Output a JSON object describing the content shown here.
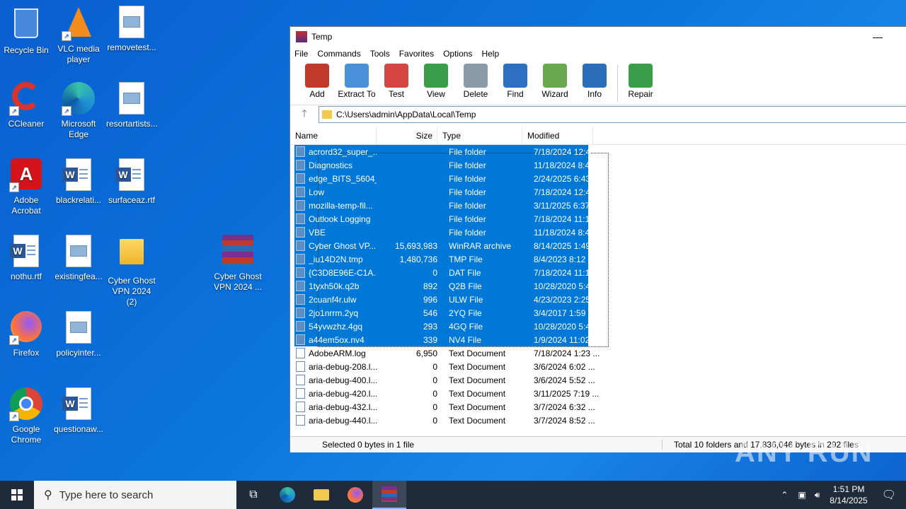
{
  "desktop": {
    "icons": [
      {
        "label": "Recycle Bin"
      },
      {
        "label": "VLC media player"
      },
      {
        "label": "removetest..."
      },
      {
        "label": "CCleaner"
      },
      {
        "label": "Microsoft Edge"
      },
      {
        "label": "resortartists..."
      },
      {
        "label": "Adobe Acrobat"
      },
      {
        "label": "blackrelati..."
      },
      {
        "label": "surfaceaz.rtf"
      },
      {
        "label": "nothu.rtf"
      },
      {
        "label": "existingfea..."
      },
      {
        "label": "Cyber Ghost VPN 2024 (2)"
      },
      {
        "label": "Cyber Ghost VPN 2024 ..."
      },
      {
        "label": "Firefox"
      },
      {
        "label": "policyinter..."
      },
      {
        "label": "Google Chrome"
      },
      {
        "label": "questionaw..."
      }
    ]
  },
  "window": {
    "title": "Temp",
    "minimize_glyph": "—",
    "menu": [
      "File",
      "Commands",
      "Tools",
      "Favorites",
      "Options",
      "Help"
    ],
    "toolbar": [
      {
        "label": "Add",
        "icon": "add-archive-icon",
        "color": "#c0392b"
      },
      {
        "label": "Extract To",
        "icon": "extract-folder-icon",
        "color": "#4a90d9"
      },
      {
        "label": "Test",
        "icon": "test-clipboard-icon",
        "color": "#d64541"
      },
      {
        "label": "View",
        "icon": "view-book-icon",
        "color": "#3a9d4a"
      },
      {
        "label": "Delete",
        "icon": "trash-icon",
        "color": "#8a9aa8"
      },
      {
        "label": "Find",
        "icon": "magnifier-icon",
        "color": "#2d6fc0"
      },
      {
        "label": "Wizard",
        "icon": "wand-icon",
        "color": "#6aa84f"
      },
      {
        "label": "Info",
        "icon": "info-icon",
        "color": "#2a6db8"
      },
      {
        "label": "Repair",
        "icon": "repair-icon",
        "color": "#3a9d4a"
      }
    ],
    "address": "C:\\Users\\admin\\AppData\\Local\\Temp",
    "columns": {
      "name": "Name",
      "size": "Size",
      "type": "Type",
      "modified": "Modified"
    },
    "files": [
      {
        "name": "acrord32_super_...",
        "size": "",
        "type": "File folder",
        "modified": "7/18/2024 12:4...",
        "selected": true
      },
      {
        "name": "Diagnostics",
        "size": "",
        "type": "File folder",
        "modified": "11/18/2024 8:4...",
        "selected": true
      },
      {
        "name": "edge_BITS_5604_...",
        "size": "",
        "type": "File folder",
        "modified": "2/24/2025 6:43 ...",
        "selected": true
      },
      {
        "name": "Low",
        "size": "",
        "type": "File folder",
        "modified": "7/18/2024 12:4...",
        "selected": true
      },
      {
        "name": "mozilla-temp-fil...",
        "size": "",
        "type": "File folder",
        "modified": "3/11/2025 6:37 ...",
        "selected": true
      },
      {
        "name": "Outlook Logging",
        "size": "",
        "type": "File folder",
        "modified": "7/18/2024 11:1...",
        "selected": true
      },
      {
        "name": "VBE",
        "size": "",
        "type": "File folder",
        "modified": "11/18/2024 8:4...",
        "selected": true
      },
      {
        "name": "Cyber Ghost VP...",
        "size": "15,693,983",
        "type": "WinRAR archive",
        "modified": "8/14/2025 1:49 ...",
        "selected": true
      },
      {
        "name": "_iu14D2N.tmp",
        "size": "1,480,736",
        "type": "TMP File",
        "modified": "8/4/2023 8:12 ...",
        "selected": true
      },
      {
        "name": "{C3D8E96E-C1A...",
        "size": "0",
        "type": "DAT File",
        "modified": "7/18/2024 11:1...",
        "selected": true
      },
      {
        "name": "1tyxh50k.q2b",
        "size": "892",
        "type": "Q2B File",
        "modified": "10/28/2020 5:4...",
        "selected": true
      },
      {
        "name": "2cuanf4r.ulw",
        "size": "996",
        "type": "ULW File",
        "modified": "4/23/2023 2:25 ...",
        "selected": true
      },
      {
        "name": "2jo1nrrm.2yq",
        "size": "546",
        "type": "2YQ File",
        "modified": "3/4/2017 1:59 ...",
        "selected": true
      },
      {
        "name": "54yvwzhz.4gq",
        "size": "293",
        "type": "4GQ File",
        "modified": "10/28/2020 5:4...",
        "selected": true
      },
      {
        "name": "a44em5ox.nv4",
        "size": "339",
        "type": "NV4 File",
        "modified": "1/9/2024 11:02 ...",
        "selected": true
      },
      {
        "name": "AdobeARM.log",
        "size": "6,950",
        "type": "Text Document",
        "modified": "7/18/2024 1:23 ...",
        "selected": false
      },
      {
        "name": "aria-debug-208.l...",
        "size": "0",
        "type": "Text Document",
        "modified": "3/6/2024 6:02 ...",
        "selected": false
      },
      {
        "name": "aria-debug-400.l...",
        "size": "0",
        "type": "Text Document",
        "modified": "3/6/2024 5:52 ...",
        "selected": false
      },
      {
        "name": "aria-debug-420.l...",
        "size": "0",
        "type": "Text Document",
        "modified": "3/11/2025 7:19 ...",
        "selected": false
      },
      {
        "name": "aria-debug-432.l...",
        "size": "0",
        "type": "Text Document",
        "modified": "3/7/2024 6:32 ...",
        "selected": false
      },
      {
        "name": "aria-debug-440.l...",
        "size": "0",
        "type": "Text Document",
        "modified": "3/7/2024 8:52 ...",
        "selected": false
      }
    ],
    "status_left": "Selected 0 bytes in 1 file",
    "status_right": "Total 10 folders and 17,836,046 bytes in 292 files"
  },
  "taskbar": {
    "search_placeholder": "Type here to search",
    "time": "1:51 PM",
    "date": "8/14/2025"
  },
  "watermark": "ANY RUN"
}
